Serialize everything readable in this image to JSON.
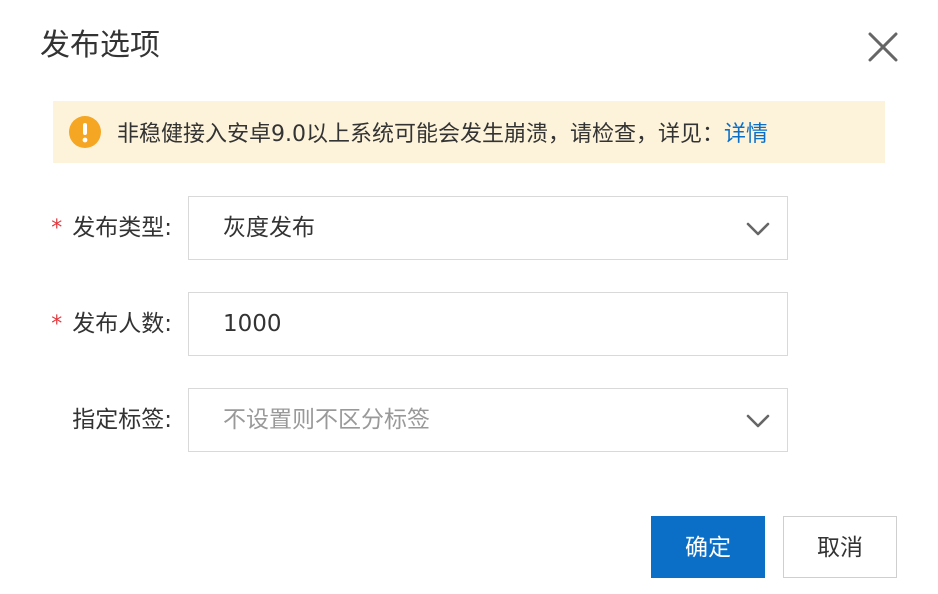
{
  "dialog": {
    "title": "发布选项",
    "close_icon": "close-icon"
  },
  "alert": {
    "icon": "warning-icon",
    "icon_color": "#f5a623",
    "background": "#fdf3da",
    "message": "非稳健接入安卓9.0以上系统可能会发生崩溃，请检查，详见：",
    "link_text": "详情",
    "link_color": "#0b6fc8"
  },
  "form": {
    "required_mark": "*",
    "release_type": {
      "label": "发布类型:",
      "required": true,
      "value": "灰度发布"
    },
    "release_count": {
      "label": "发布人数:",
      "required": true,
      "value": "1000"
    },
    "tags": {
      "label": "指定标签:",
      "required": false,
      "placeholder": "不设置则不区分标签"
    }
  },
  "buttons": {
    "confirm_label": "确定",
    "cancel_label": "取消",
    "primary_color": "#0b6fc8"
  }
}
